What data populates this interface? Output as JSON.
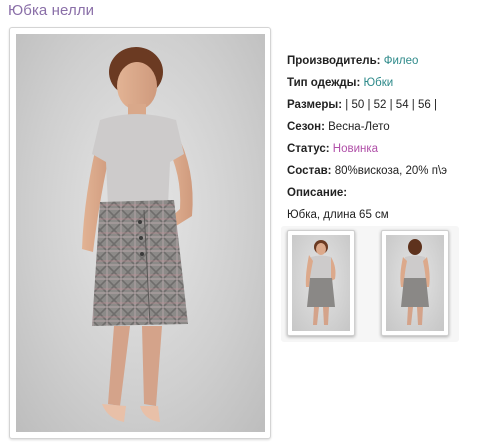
{
  "page": {
    "title": "Юбка нелли"
  },
  "details": {
    "manufacturer_label": "Производитель:",
    "manufacturer_value": "Филео",
    "type_label": "Тип одежды:",
    "type_value": "Юбки",
    "sizes_label": "Размеры:",
    "sizes_value": "| 50 | 52 | 54 | 56 |",
    "season_label": "Сезон:",
    "season_value": "Весна-Лето",
    "status_label": "Статус:",
    "status_value": "Новинка",
    "composition_label": "Состав:",
    "composition_value": "80%вискоза, 20% п\\э",
    "description_label": "Описание:",
    "description_value": "Юбка, длина 65 см"
  },
  "colors": {
    "title": "#8a6fa8",
    "link": "#2e8a8a",
    "status": "#b04fa8"
  },
  "thumbnails": [
    {
      "view": "front"
    },
    {
      "view": "back"
    }
  ]
}
